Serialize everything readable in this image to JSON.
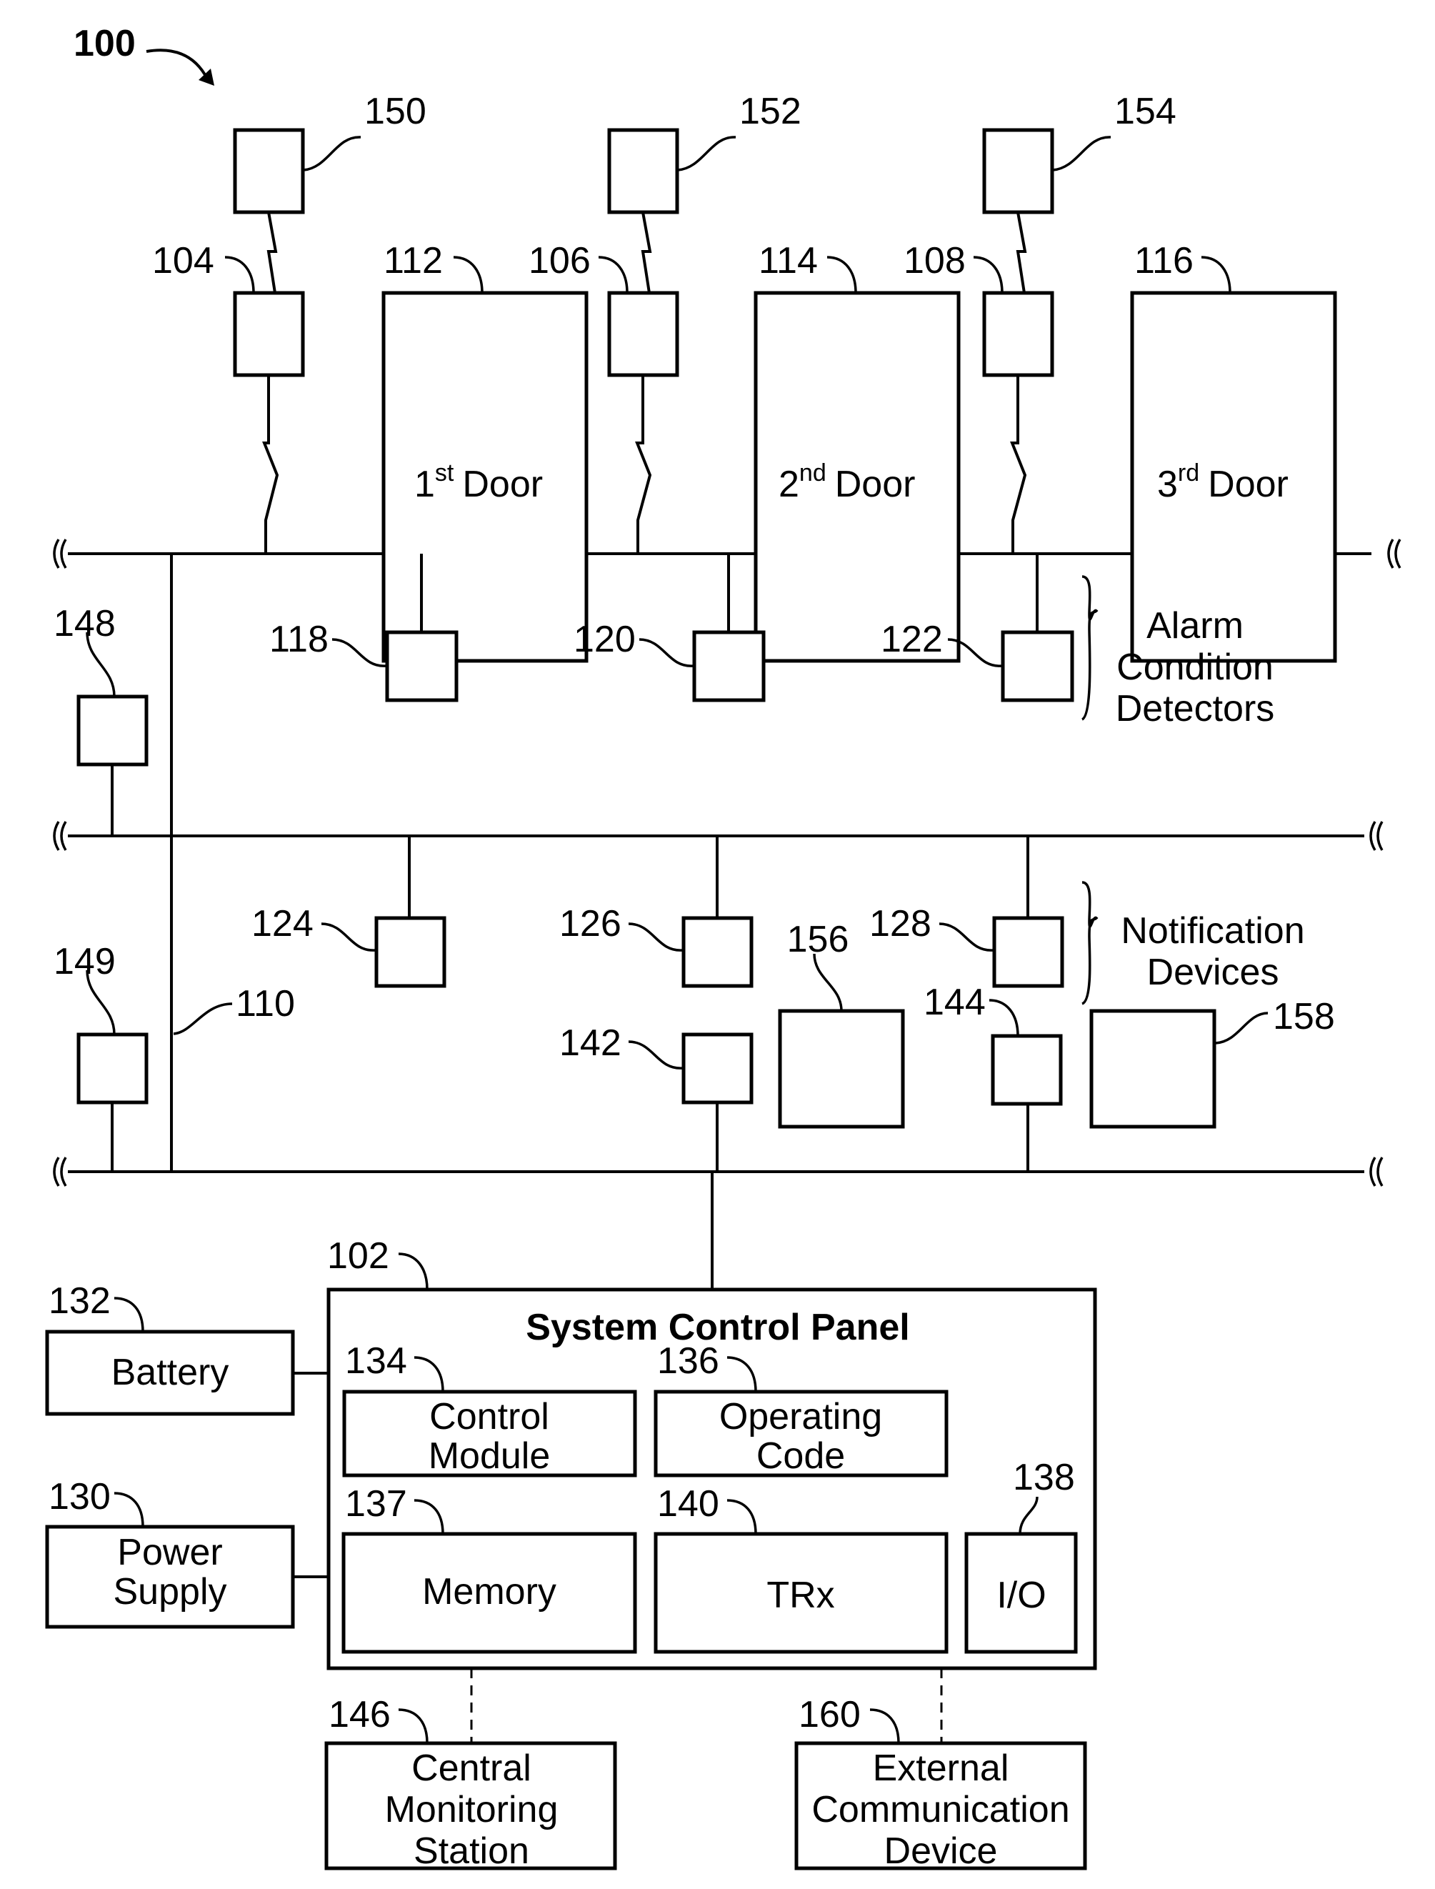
{
  "figure": {
    "ref": "100",
    "doors": [
      {
        "ref": "112",
        "ordinal": "1",
        "suffix": "st",
        "word": "Door"
      },
      {
        "ref": "114",
        "ordinal": "2",
        "suffix": "nd",
        "word": "Door"
      },
      {
        "ref": "116",
        "ordinal": "3",
        "suffix": "rd",
        "word": "Door"
      }
    ],
    "door_controllers": [
      "104",
      "106",
      "108"
    ],
    "door_readers": [
      "150",
      "152",
      "154"
    ],
    "bus_ref": "110",
    "detectors": [
      "118",
      "120",
      "122"
    ],
    "detectors_group_label": [
      "Alarm",
      "Condition",
      "Detectors"
    ],
    "notification": [
      "124",
      "126",
      "128"
    ],
    "notification_group_label": [
      "Notification",
      "Devices"
    ],
    "side_devices": [
      "148",
      "149"
    ],
    "lower_devices": [
      "142",
      "144",
      "156",
      "158"
    ],
    "panel": {
      "ref": "102",
      "title": "System Control Panel",
      "control_module": {
        "ref": "134",
        "lines": [
          "Control",
          "Module"
        ]
      },
      "operating_code": {
        "ref": "136",
        "lines": [
          "Operating",
          "Code"
        ]
      },
      "memory": {
        "ref": "137",
        "label": "Memory"
      },
      "trx": {
        "ref": "140",
        "label": "TRx"
      },
      "io": {
        "ref": "138",
        "label": "I/O"
      }
    },
    "battery": {
      "ref": "132",
      "label": "Battery"
    },
    "power_supply": {
      "ref": "130",
      "lines": [
        "Power",
        "Supply"
      ]
    },
    "central_monitoring": {
      "ref": "146",
      "lines": [
        "Central",
        "Monitoring",
        "Station"
      ]
    },
    "external_comm": {
      "ref": "160",
      "lines": [
        "External",
        "Communication",
        "Device"
      ]
    }
  }
}
